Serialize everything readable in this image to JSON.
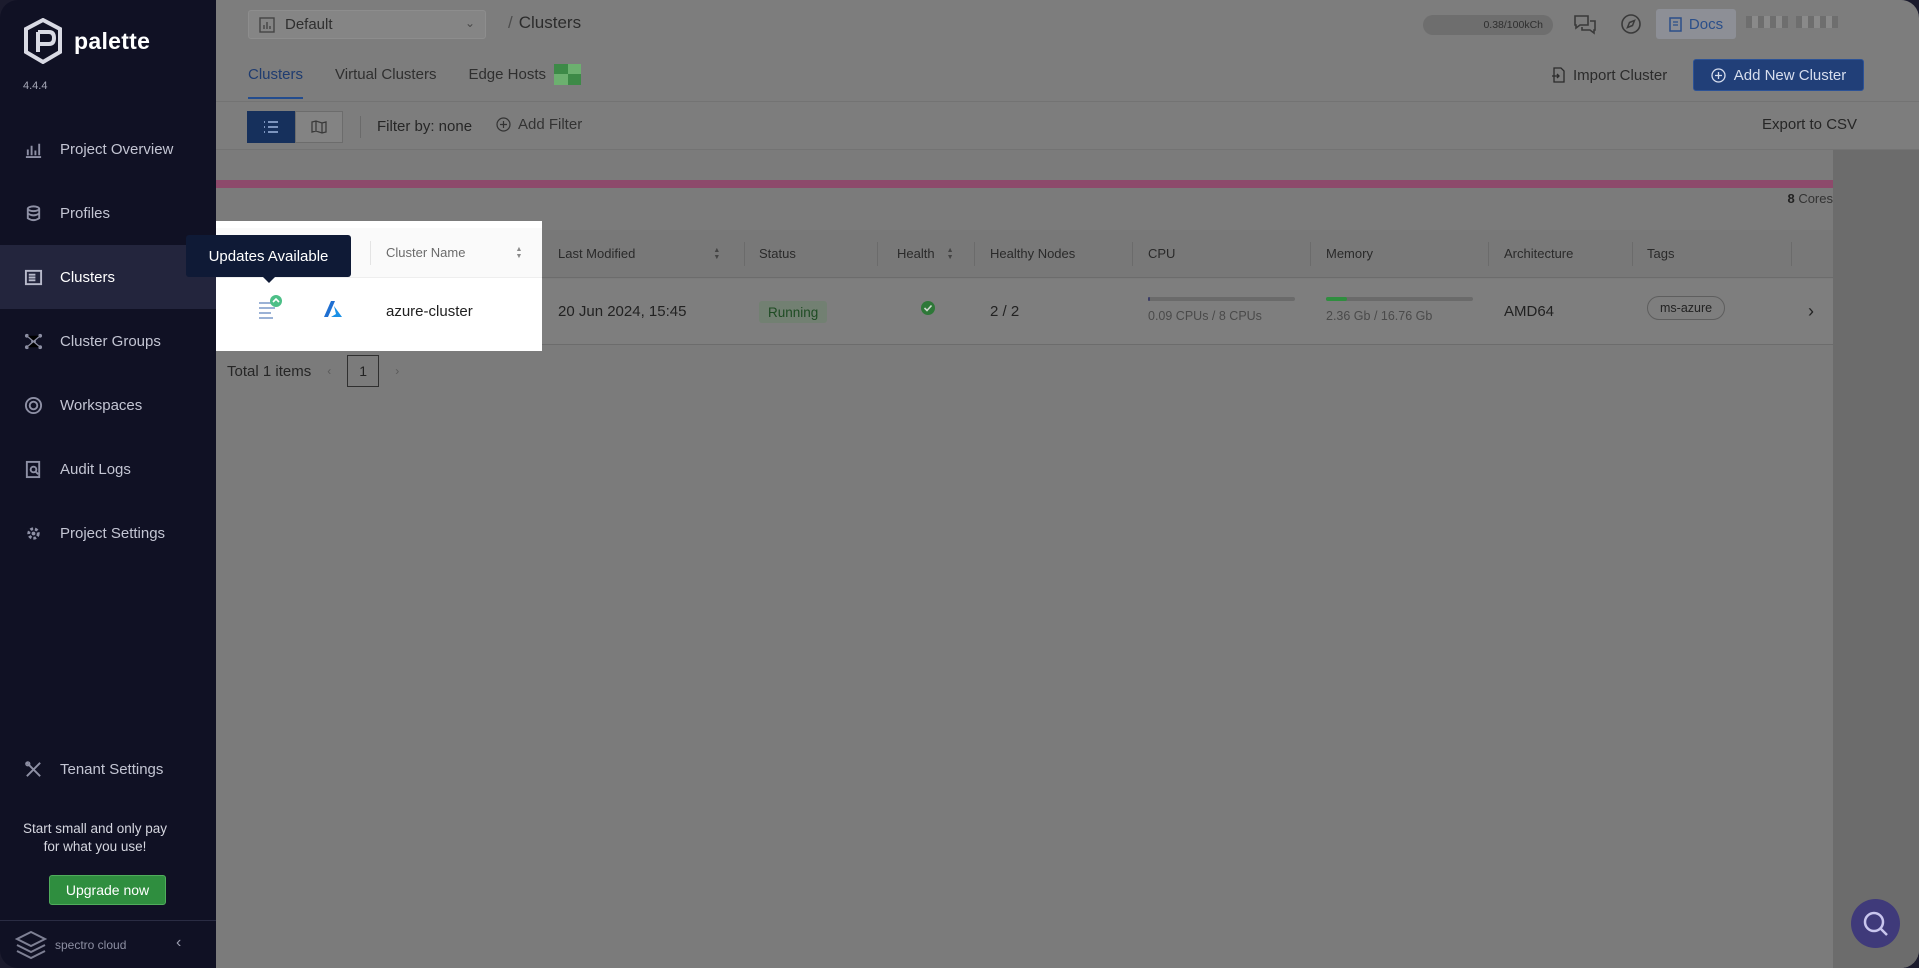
{
  "app": {
    "name": "palette",
    "version": "4.4.4"
  },
  "sidebar": {
    "items": [
      {
        "label": "Project Overview",
        "icon": "chart-icon"
      },
      {
        "label": "Profiles",
        "icon": "stack-icon"
      },
      {
        "label": "Clusters",
        "icon": "clusters-icon",
        "active": true
      },
      {
        "label": "Cluster Groups",
        "icon": "cluster-groups-icon"
      },
      {
        "label": "Workspaces",
        "icon": "workspaces-icon"
      },
      {
        "label": "Audit Logs",
        "icon": "audit-logs-icon"
      },
      {
        "label": "Project Settings",
        "icon": "gear-icon"
      }
    ],
    "tenant_settings": "Tenant Settings",
    "promo_line1": "Start small and only pay",
    "promo_line2": "for what you use!",
    "upgrade_label": "Upgrade now",
    "footer_brand": "spectro cloud"
  },
  "topbar": {
    "project": "Default",
    "breadcrumb": "Clusters",
    "usage": "0.38/100kCh",
    "docs_label": "Docs"
  },
  "tabs": [
    {
      "label": "Clusters",
      "active": true
    },
    {
      "label": "Virtual Clusters"
    },
    {
      "label": "Edge Hosts"
    }
  ],
  "actions": {
    "import_label": "Import Cluster",
    "add_label": "Add New Cluster"
  },
  "filterbar": {
    "filter_by": "Filter by: none",
    "add_filter": "Add Filter",
    "export": "Export to CSV"
  },
  "summary": {
    "cores_value": "8",
    "cores_unit": "Cores"
  },
  "table": {
    "columns": [
      "Cluster Name",
      "Last Modified",
      "Status",
      "Health",
      "Healthy Nodes",
      "CPU",
      "Memory",
      "Architecture",
      "Tags"
    ],
    "rows": [
      {
        "name": "azure-cluster",
        "last_modified": "20 Jun 2024, 15:45",
        "status": "Running",
        "healthy_nodes": "2 / 2",
        "cpu_label": "0.09 CPUs / 8 CPUs",
        "cpu_fraction": 0.011,
        "memory_label": "2.36 Gb / 16.76 Gb",
        "memory_fraction": 0.14,
        "architecture": "AMD64",
        "tag": "ms-azure"
      }
    ]
  },
  "pagination": {
    "total": "Total 1 items",
    "page": "1"
  },
  "tooltip": "Updates Available",
  "colors": {
    "sidebar_bg": "#101124",
    "primary": "#234c8e",
    "success": "#2f8e3f",
    "tooltip_bg": "#0f1a36"
  }
}
